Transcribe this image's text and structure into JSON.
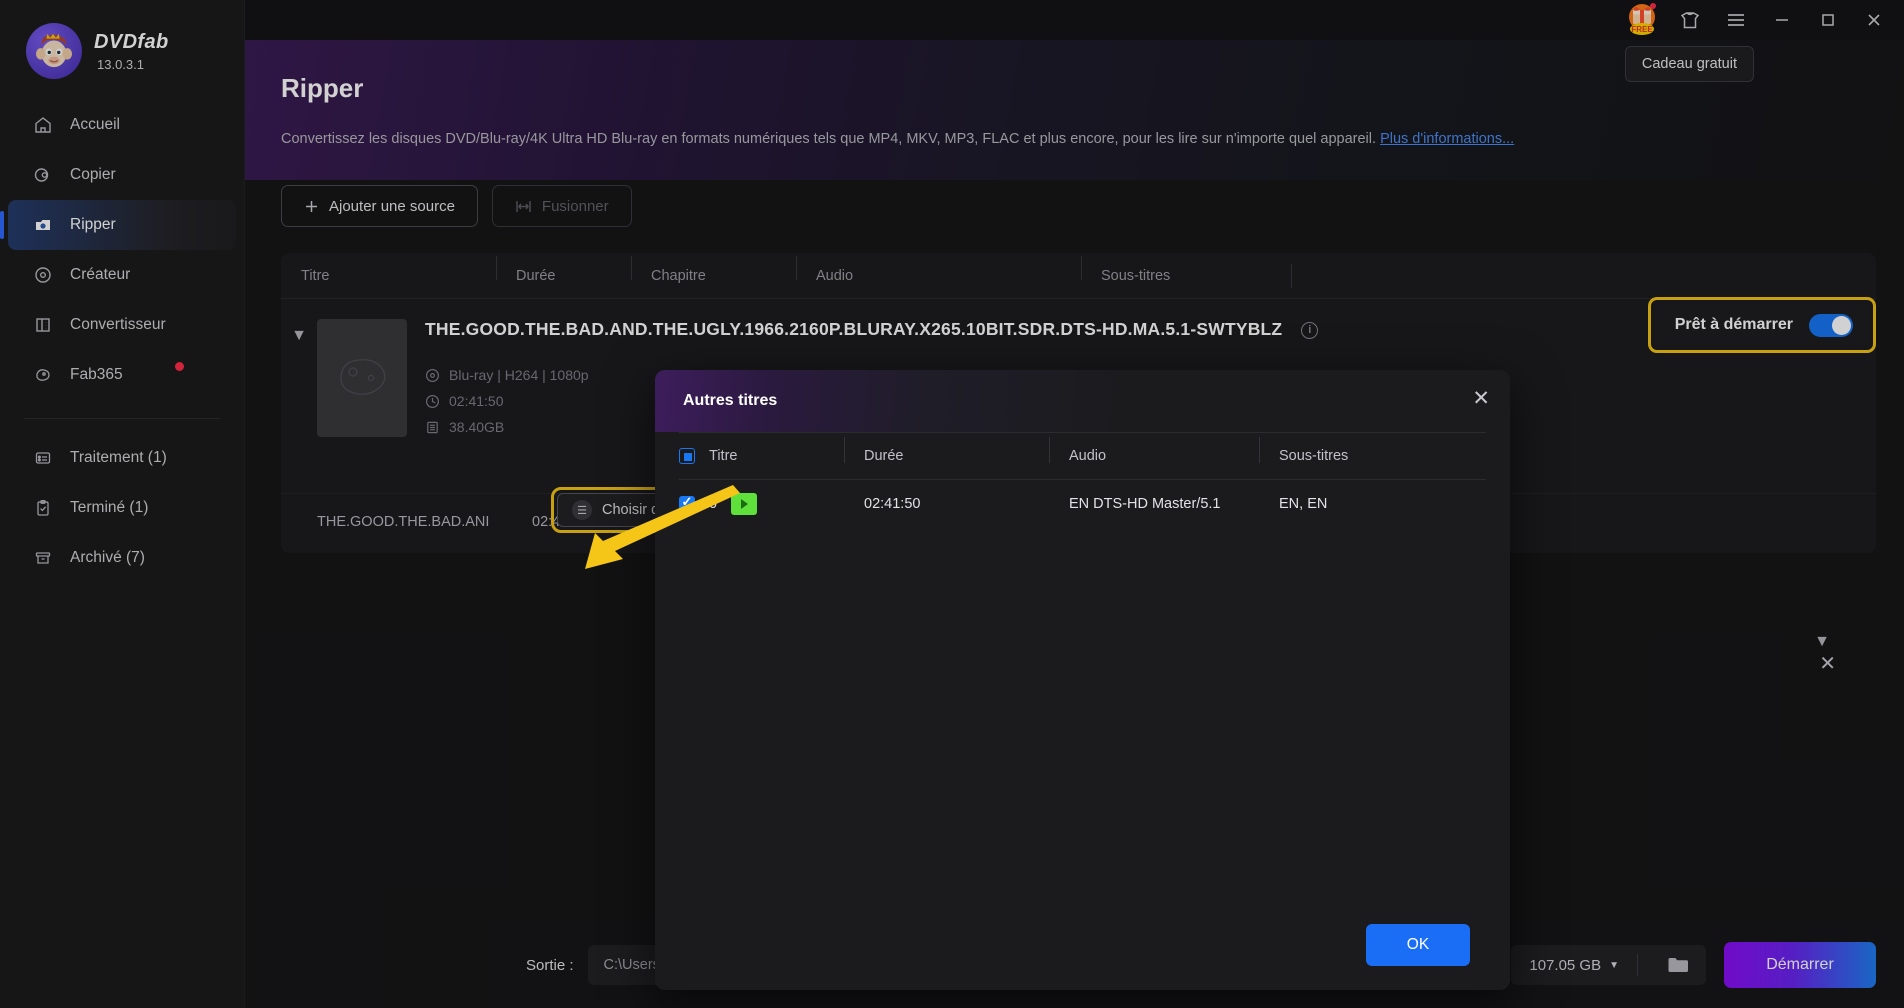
{
  "app": {
    "brand": "DVDfab",
    "version": "13.0.3.1"
  },
  "titlebar": {
    "gift_icon": "gift-free-icon",
    "shirt_icon": "shirt-icon",
    "menu_icon": "hamburger-menu-icon",
    "minimize_icon": "minimize-icon",
    "maximize_icon": "maximize-icon",
    "close_icon": "close-icon",
    "tooltip": "Cadeau gratuit"
  },
  "sidebar": {
    "items": [
      {
        "label": "Accueil",
        "icon": "home-icon",
        "active": false
      },
      {
        "label": "Copier",
        "icon": "disc-copy-icon",
        "active": false
      },
      {
        "label": "Ripper",
        "icon": "ripper-icon",
        "active": true
      },
      {
        "label": "Créateur",
        "icon": "disc-creator-icon",
        "active": false
      },
      {
        "label": "Convertisseur",
        "icon": "film-convert-icon",
        "active": false
      },
      {
        "label": "Fab365",
        "icon": "fab365-icon",
        "active": false,
        "badge": true
      }
    ],
    "secondary": [
      {
        "label": "Traitement (1)",
        "icon": "processing-list-icon"
      },
      {
        "label": "Terminé (1)",
        "icon": "clipboard-check-icon"
      },
      {
        "label": "Archivé (7)",
        "icon": "archive-icon"
      }
    ]
  },
  "main": {
    "title": "Ripper",
    "description": "Convertissez les disques DVD/Blu-ray/4K Ultra HD Blu-ray en formats numériques tels que MP4, MKV, MP3, FLAC et plus encore, pour les lire sur n'importe quel appareil.",
    "more_link": "Plus d'informations...",
    "add_source_label": "Ajouter une source",
    "merge_label": "Fusionner",
    "columns": [
      "Titre",
      "Durée",
      "Chapitre",
      "Audio",
      "Sous-titres"
    ],
    "row": {
      "file_title": "THE.GOOD.THE.BAD.AND.THE.UGLY.1966.2160P.BLURAY.X265.10BIT.SDR.DTS-HD.MA.5.1-SWTYBLZ",
      "format": "Blu-ray | H264 | 1080p",
      "duration": "02:41:50",
      "size": "38.40GB",
      "choose_titles_label": "Choisir d'autres titres",
      "ready_label": "Prêt à démarrer",
      "ready_on": true
    },
    "subrow": {
      "title": "THE.GOOD.THE.BAD.ANI",
      "duration": "02:41:50"
    }
  },
  "modal": {
    "title": "Autres titres",
    "columns": [
      "Titre",
      "Durée",
      "Audio",
      "Sous-titres"
    ],
    "rows": [
      {
        "title": "0",
        "duration": "02:41:50",
        "audio": "EN  DTS-HD Master/5.1",
        "subtitles": "EN, EN",
        "checked": true
      }
    ],
    "ok_label": "OK",
    "close_icon": "close-icon"
  },
  "bottombar": {
    "output_label": "Sortie :",
    "output_path": "C:\\Users\\fab\\Documents\\DVDFab\\D",
    "size_value": "107.05 GB",
    "folder_icon": "folder-icon",
    "start_label": "Démarrer"
  },
  "colors": {
    "accent_blue": "#1877f2",
    "highlight_yellow": "#f5c518",
    "start_gradient_from": "#8a0ef5",
    "start_gradient_to": "#1f7ef0",
    "badge_red": "#ff2c4a",
    "play_green": "#5fe03b"
  }
}
